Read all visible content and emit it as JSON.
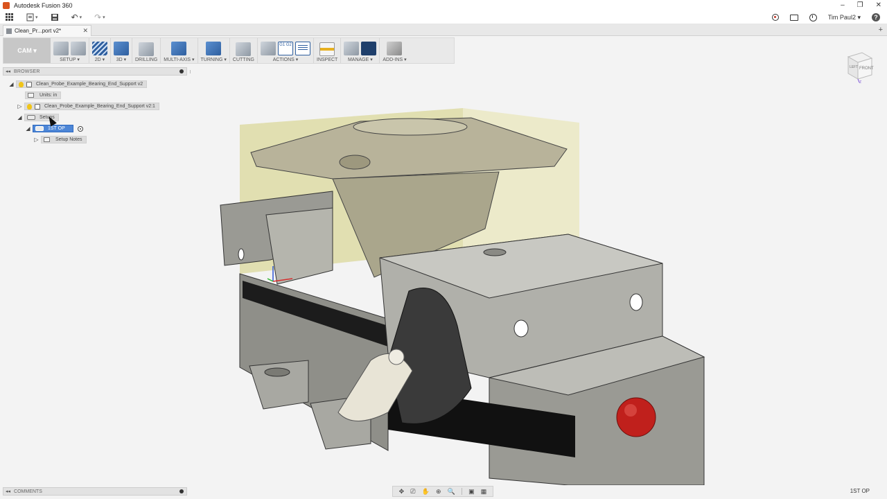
{
  "app": {
    "title": "Autodesk Fusion 360",
    "user": "Tim Paul2"
  },
  "qab": {
    "undo": "↶",
    "redo": "↷",
    "caret": "▾"
  },
  "window_controls": [
    "–",
    "❐",
    "✕"
  ],
  "doc_tab": {
    "label": "Clean_Pr...port v2*",
    "close": "✕",
    "add": "+"
  },
  "toolbar": {
    "workspace": "CAM ▾",
    "groups": [
      {
        "label": "SETUP ▾",
        "icons": [
          "setup-icon",
          "setup-sheet-icon"
        ]
      },
      {
        "label": "2D ▾",
        "icons": [
          "2d-pocket-icon"
        ]
      },
      {
        "label": "3D ▾",
        "icons": [
          "3d-adaptive-icon"
        ]
      },
      {
        "label": "DRILLING",
        "icons": [
          "drill-icon"
        ]
      },
      {
        "label": "MULTI-AXIS ▾",
        "icons": [
          "multi-axis-icon"
        ]
      },
      {
        "label": "TURNING ▾",
        "icons": [
          "turning-icon"
        ]
      },
      {
        "label": "CUTTING",
        "icons": [
          "cutting-icon"
        ]
      },
      {
        "label": "ACTIONS ▾",
        "icons": [
          "simulate-icon",
          "post-process-icon",
          "setup-sheet-doc-icon"
        ]
      },
      {
        "label": "INSPECT",
        "icons": [
          "measure-icon"
        ]
      },
      {
        "label": "MANAGE ▾",
        "icons": [
          "tool-library-icon",
          "template-icon"
        ]
      },
      {
        "label": "ADD-INS ▾",
        "icons": [
          "scripts-addins-icon"
        ]
      }
    ],
    "g1g2": "G1 G2"
  },
  "browser": {
    "title": "BROWSER",
    "collapse": "◂◂",
    "tree": [
      {
        "label": "Clean_Probe_Example_Bearing_End_Support v2",
        "toggle": "◢"
      },
      {
        "label": "Units: in",
        "toggle": ""
      },
      {
        "label": "Clean_Probe_Example_Bearing_End_Support v2:1",
        "toggle": "▷"
      },
      {
        "label": "Setups",
        "toggle": "◢"
      },
      {
        "label": "1ST OP",
        "toggle": "◢",
        "selected": true
      },
      {
        "label": "Setup Notes",
        "toggle": "▷"
      }
    ]
  },
  "viewcube": {
    "left": "LEFT",
    "front": "FRONT",
    "axis_x": "X",
    "axis_z": "Z"
  },
  "comments": {
    "title": "COMMENTS",
    "collapse": "◂◂"
  },
  "navbar": {
    "items": [
      "✥",
      "⎚",
      "✋",
      "⊕",
      "🔍",
      "▣",
      "▦"
    ]
  },
  "status": {
    "active_setup": "1ST OP"
  }
}
